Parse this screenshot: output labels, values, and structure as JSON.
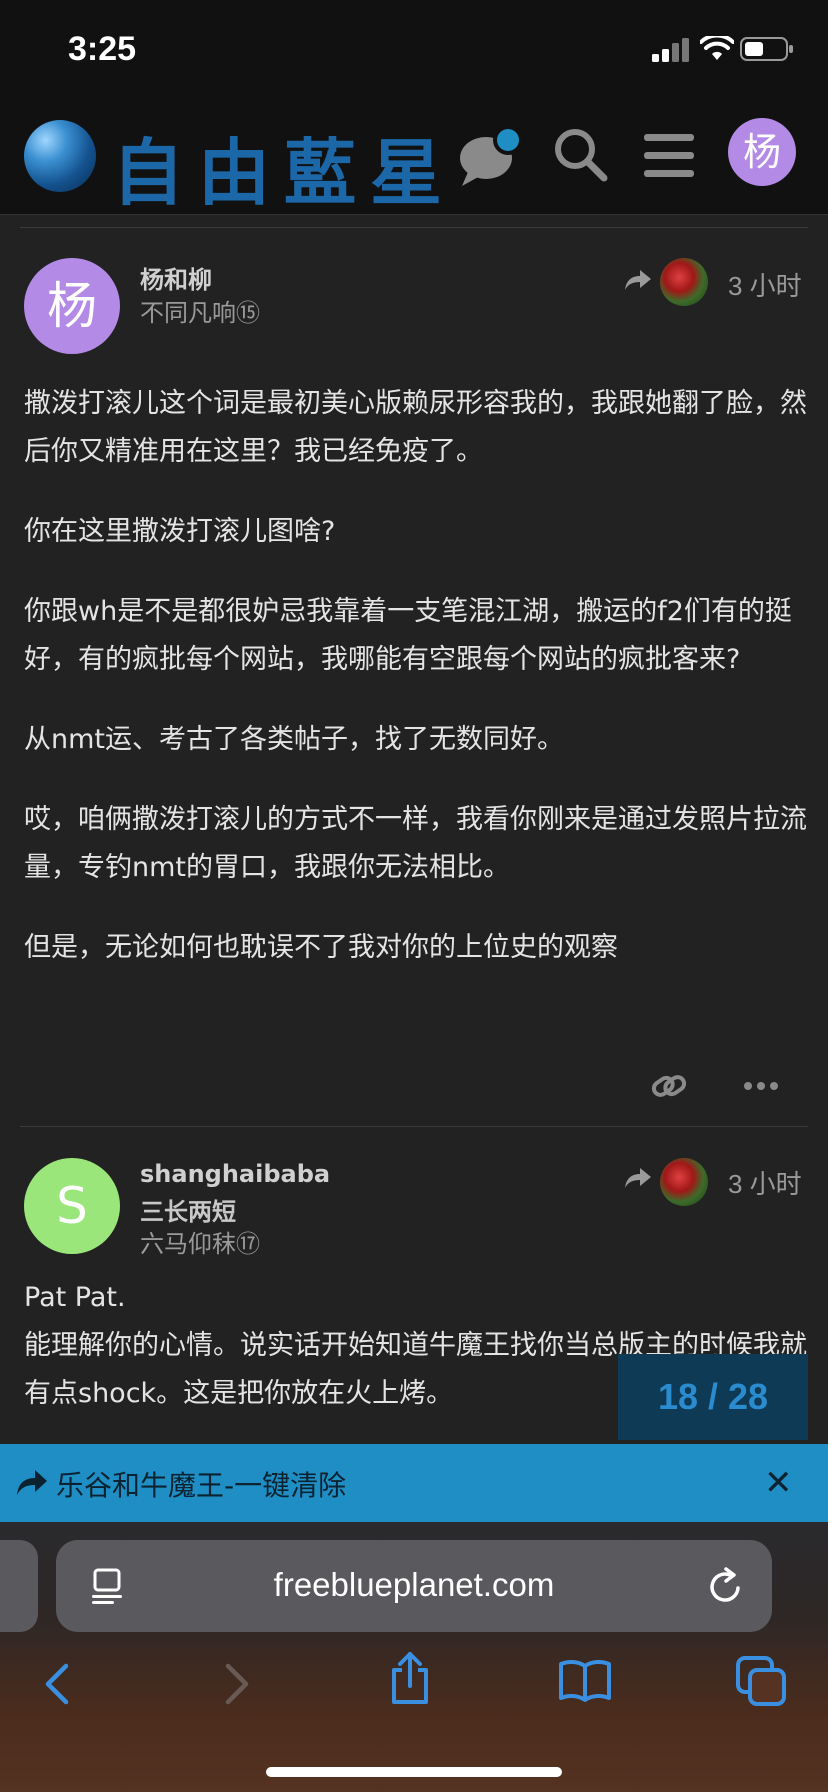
{
  "status_bar": {
    "time": "3:25"
  },
  "header": {
    "site_name": "自由藍星",
    "user_initial": "杨"
  },
  "posts": [
    {
      "author_initial": "杨",
      "author_initial_color": "#b38ae6",
      "username": "杨和柳",
      "title": "",
      "user_title": "不同凡响⑮",
      "time": "3 小时",
      "paragraphs": [
        "撒泼打滚儿这个词是最初美心版赖尿形容我的，我跟她翻了脸，然后你又精准用在这里？我已经免疫了。",
        "你在这里撒泼打滚儿图啥?",
        "你跟wh是不是都很妒忌我靠着一支笔混江湖，搬运的f2们有的挺好，有的疯批每个网站，我哪能有空跟每个网站的疯批客来?",
        "从nmt运、考古了各类帖子，找了无数同好。",
        "哎，咱俩撒泼打滚儿的方式不一样，我看你刚来是通过发照片拉流量，专钓nmt的胃口，我跟你无法相比。",
        "但是，无论如何也耽误不了我对你的上位史的观察"
      ]
    },
    {
      "author_initial": "S",
      "author_initial_color": "#9ae67a",
      "username": "shanghaibaba",
      "flair": "三长两短",
      "user_title": "六马仰秣⑰",
      "time": "3 小时",
      "paragraphs": [
        "Pat Pat.",
        "能理解你的心情。说实话开始知道牛魔王找你当总版主的时候我就有点shock。这是把你放在火上烤。"
      ]
    }
  ],
  "progress": {
    "label": "18 / 28",
    "current": 18,
    "total": 28
  },
  "topic_banner": {
    "title": "乐谷和牛魔王-一键清除"
  },
  "browser": {
    "url": "freeblueplanet.com"
  },
  "colors": {
    "background": "#222222",
    "header": "#111111",
    "brand_blue": "#1c67a8",
    "banner": "#1f8ec4",
    "safari_accent": "#3a8fe0"
  }
}
